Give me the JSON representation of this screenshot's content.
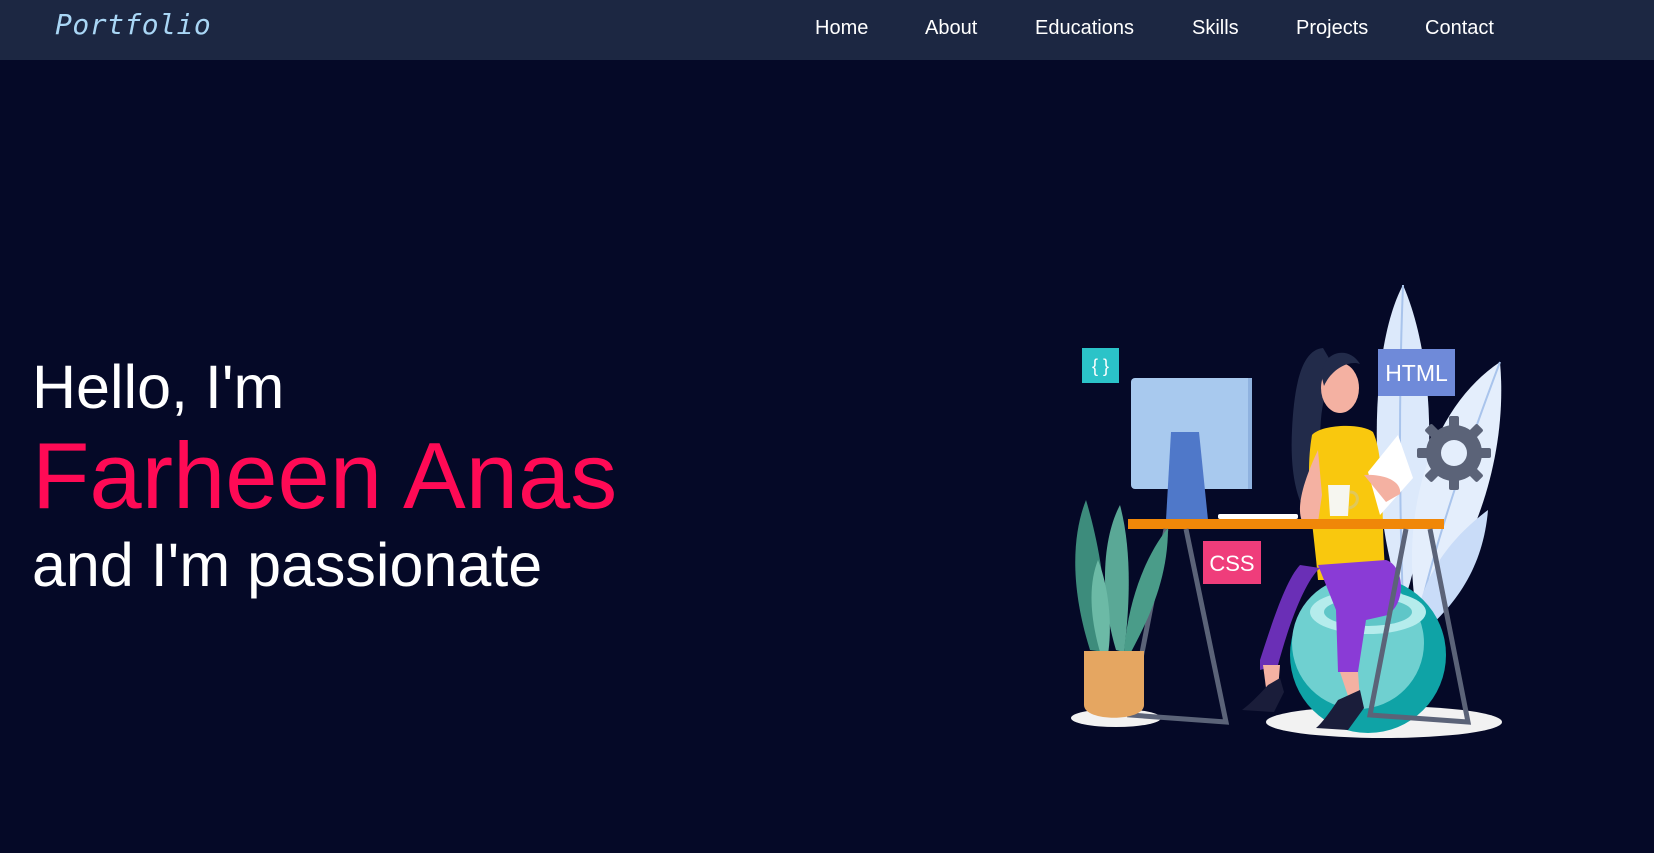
{
  "navbar": {
    "brand": "Portfolio",
    "links": [
      {
        "label": "Home"
      },
      {
        "label": "About"
      },
      {
        "label": "Educations"
      },
      {
        "label": "Skills"
      },
      {
        "label": "Projects"
      },
      {
        "label": "Contact"
      }
    ]
  },
  "hero": {
    "greeting": "Hello, I'm",
    "name": "Farheen Anas",
    "tagline": "and I'm passionate",
    "illustration": {
      "tags": {
        "braces": "{ }",
        "html": "HTML",
        "css": "CSS"
      }
    }
  },
  "colors": {
    "background": "#050927",
    "navbar": "#1c2742",
    "brand": "#a9d6f5",
    "accent": "#ff0a55",
    "text": "#ffffff"
  }
}
